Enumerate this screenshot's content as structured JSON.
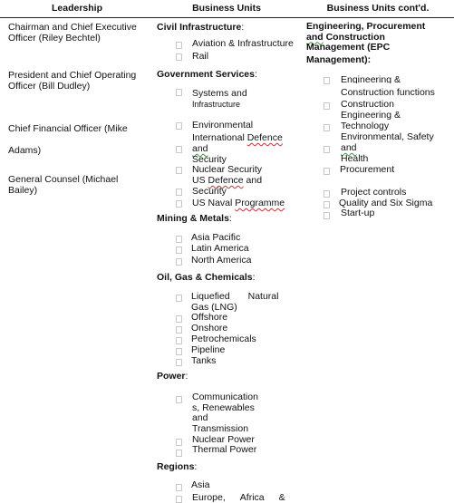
{
  "headers": {
    "leadership": "Leadership",
    "business_units": "Business Units",
    "business_units_contd": "Business Units cont'd."
  },
  "leadership": [
    {
      "line1": "Chairman and Chief Executive",
      "line2": "Officer (Riley Bechtel)"
    },
    {
      "line1": "President and Chief Operating",
      "line2": "Officer (Bill Dudley)"
    },
    {
      "line1": "Chief Financial Officer (Mike",
      "line2": "Adams)"
    },
    {
      "line1": "General Counsel (Michael",
      "line2": "Bailey)"
    }
  ],
  "business_units": {
    "civil": {
      "title": "Civil Infrastructure",
      "items": [
        "Aviation & Infrastructure",
        "Rail"
      ]
    },
    "government": {
      "title": "Government Services",
      "items": [
        "Systems and",
        "Infrastructure",
        "Environmental",
        "International",
        "Defence",
        "and",
        "Security",
        "Nuclear Security",
        "US",
        "Defence",
        "and",
        "Security",
        "US Naval",
        "Programme"
      ]
    },
    "mining": {
      "title": "Mining & Metals",
      "items": [
        "Asia Pacific",
        "Latin America",
        "North America"
      ]
    },
    "oil": {
      "title": "Oil, Gas & Chemicals",
      "items": [
        "Liquefied",
        "Natural",
        "Gas (LNG)",
        "Offshore",
        "Onshore",
        "Petrochemicals",
        "Pipeline",
        "Tanks"
      ]
    },
    "power": {
      "title": "Power",
      "items": [
        "Communication",
        "s, Renewables",
        "and",
        "Transmission",
        "Nuclear Power",
        "Thermal Power"
      ]
    },
    "regions": {
      "title": "Regions",
      "items": [
        "Asia",
        "Europe,",
        "Africa",
        "&"
      ]
    },
    "colon": ":"
  },
  "business_units_contd": {
    "title_lines": [
      "Engineering, Procurement",
      "and",
      "Construction",
      "Management (EPC",
      "Management):"
    ],
    "items": [
      "Engineering &",
      "Construction functions",
      "Construction",
      "Engineering &",
      "Technology",
      "Environmental, Safety",
      "and",
      "Health",
      "Procurement",
      "Project controls",
      "Quality and Six Sigma",
      "Start-up"
    ]
  }
}
